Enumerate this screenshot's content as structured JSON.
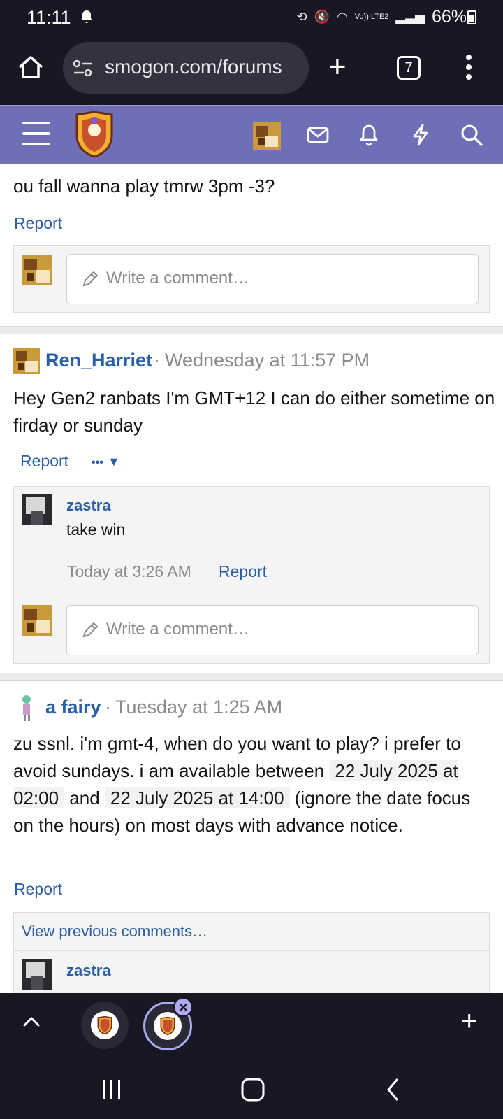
{
  "status_bar": {
    "time": "11:11",
    "battery": "66%",
    "network": "Vo)) LTE2"
  },
  "browser": {
    "url": "smogon.com/forums",
    "tab_count": "7"
  },
  "posts": [
    {
      "text": "ou fall wanna play tmrw 3pm -3?",
      "report_label": "Report",
      "comment_placeholder": "Write a comment…"
    },
    {
      "author": "Ren_Harriet",
      "time": "Wednesday at 11:57 PM",
      "separator": "·",
      "text": "Hey Gen2 ranbats I'm GMT+12 I can do either sometime on firday or sunday",
      "report_label": "Report",
      "more_label": "•••",
      "comment": {
        "author": "zastra",
        "text": "take win",
        "time": "Today at 3:26 AM",
        "report_label": "Report"
      },
      "comment_placeholder": "Write a comment…"
    },
    {
      "author": "a fairy",
      "time": "Tuesday at 1:25 AM",
      "separator": "·",
      "text_part1": "zu ssnl. i'm gmt-4, when do you want to play? i prefer to avoid sundays. i am available between ",
      "date1": "22 July 2025 at 02:00",
      "text_part2": " and ",
      "date2": "22 July 2025 at 14:00",
      "text_part3": " (ignore the date focus on the hours) on most days with advance notice.",
      "report_label": "Report",
      "view_previous": "View previous comments…",
      "next_comment_author": "zastra"
    }
  ]
}
